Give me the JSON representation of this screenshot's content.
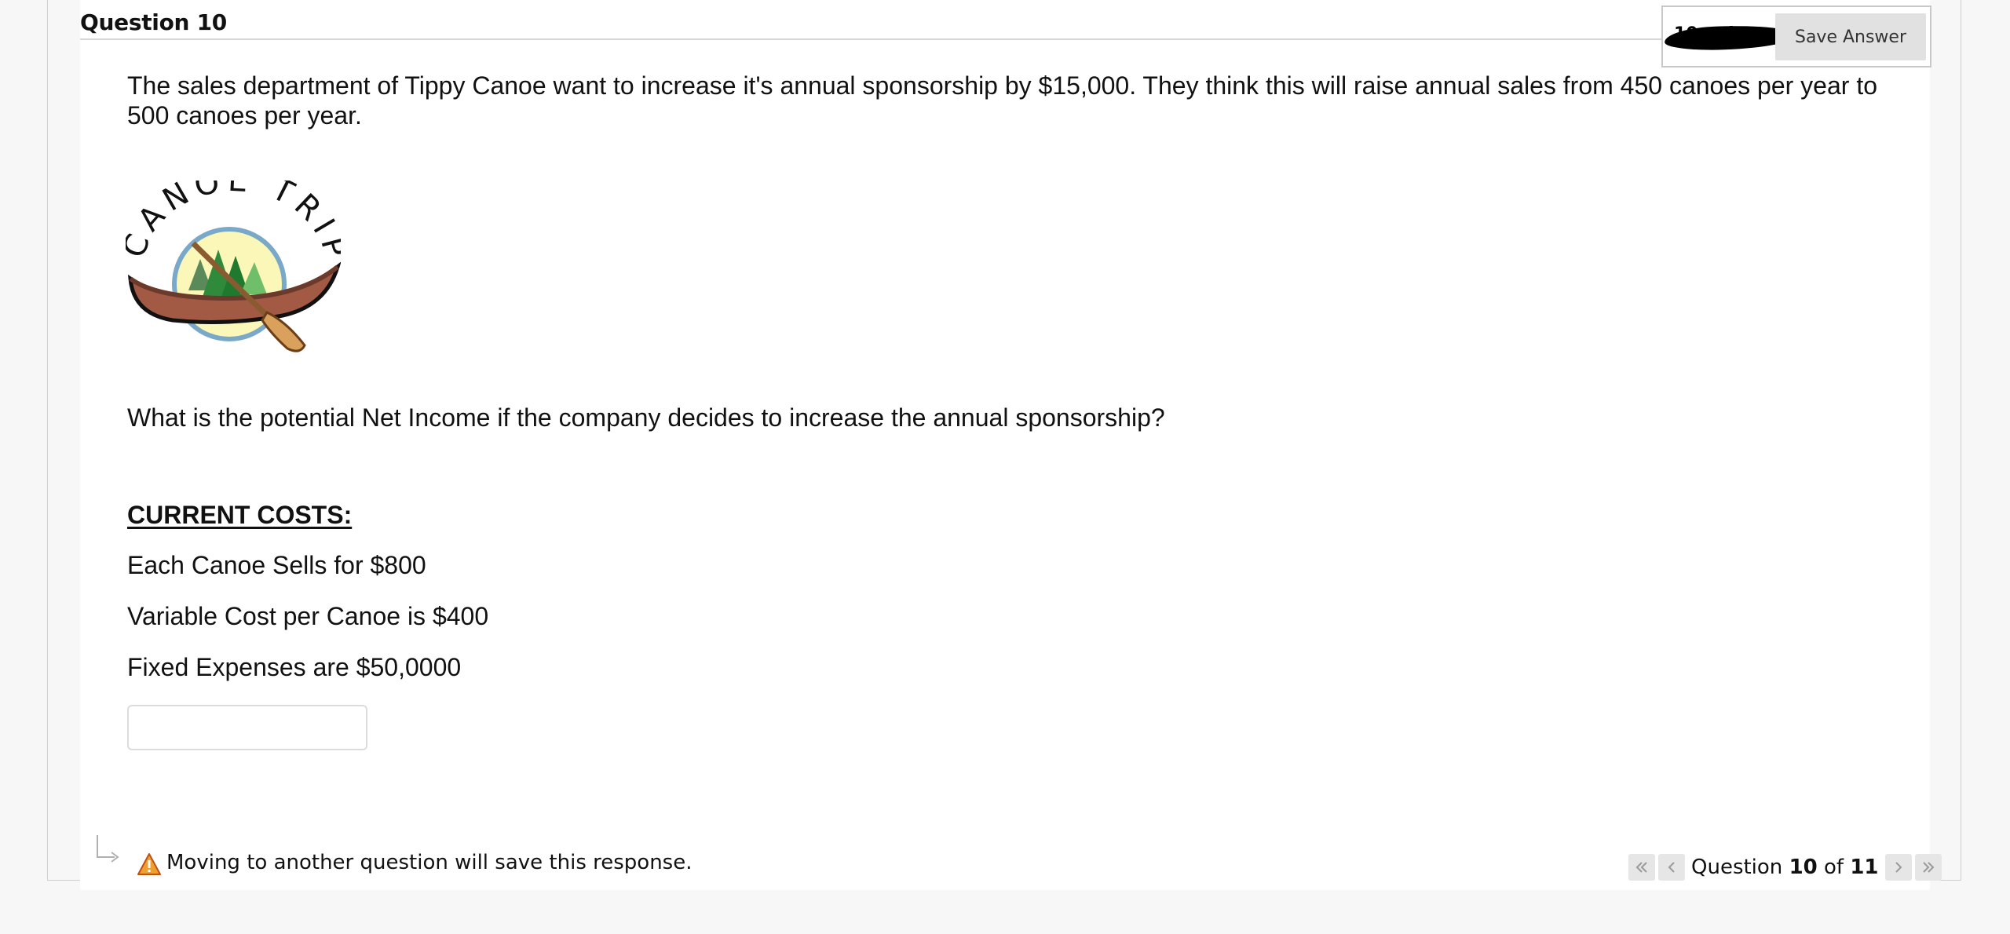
{
  "question": {
    "title": "Question 10",
    "points_label": "10 points",
    "save_button_label": "Save Answer"
  },
  "prompt": {
    "text": "The sales department of Tippy Canoe want to increase it's annual sponsorship by $15,000. They think this will raise annual sales from 450 canoes per year to 500 canoes per year.",
    "logo_text": "CANOE TRIP",
    "question_text": "What is the potential Net Income if the company decides to increase the annual sponsorship?"
  },
  "costs": {
    "heading": "CURRENT COSTS:",
    "lines": [
      "Each Canoe Sells for $800",
      "Variable Cost per Canoe is $400",
      "Fixed Expenses are $50,0000"
    ]
  },
  "answer": {
    "value": "",
    "placeholder": ""
  },
  "footer": {
    "save_note": "Moving to another question will save this response.",
    "nav_prefix": "Question",
    "nav_current": "10",
    "nav_of": "of",
    "nav_total": "11"
  },
  "icons": {
    "first": "double-chevron-left-icon",
    "prev": "chevron-left-icon",
    "next": "chevron-right-icon",
    "last": "double-chevron-right-icon",
    "warning": "warning-icon",
    "arrow": "corner-arrow-icon"
  },
  "colors": {
    "page_bg": "#f7f7f7",
    "panel_bg": "#ffffff",
    "button_bg": "#e1e1e1",
    "warning": "#f0a030"
  }
}
